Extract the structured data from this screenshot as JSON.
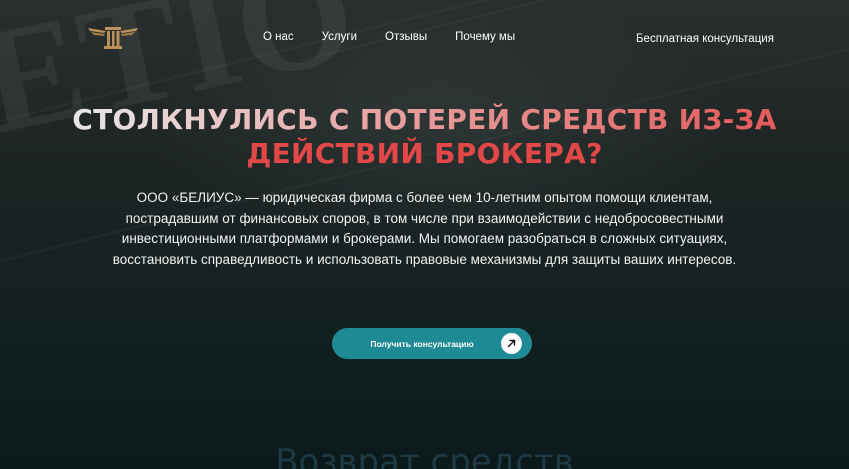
{
  "nav": {
    "items": [
      {
        "label": "О нас"
      },
      {
        "label": "Услуги"
      },
      {
        "label": "Отзывы"
      },
      {
        "label": "Почему мы"
      }
    ],
    "cta_label": "Бесплатная консультация"
  },
  "hero": {
    "headline_line1": "СТОЛКНУЛИСЬ С ПОТЕРЕЙ СРЕДСТВ ИЗ-ЗА",
    "headline_line2": "ДЕЙСТВИЙ БРОКЕРА?",
    "description": "ООО «БЕЛИУС» — юридическая фирма с более чем 10-летним опытом помощи клиентам, пострадавшим от финансовых споров, в том числе при взаимодействии с недобросовестными инвестиционными платформами и брокерами. Мы помогаем разобраться в сложных ситуациях, восстановить справедливость и использовать правовые механизмы для защиты ваших интересов.",
    "button_label": "Получить консультацию"
  },
  "next_section": {
    "title": "Возврат средств"
  },
  "colors": {
    "accent": "#1d8a95",
    "headline_red": "#e34848",
    "logo_gold": "#b8925a"
  }
}
